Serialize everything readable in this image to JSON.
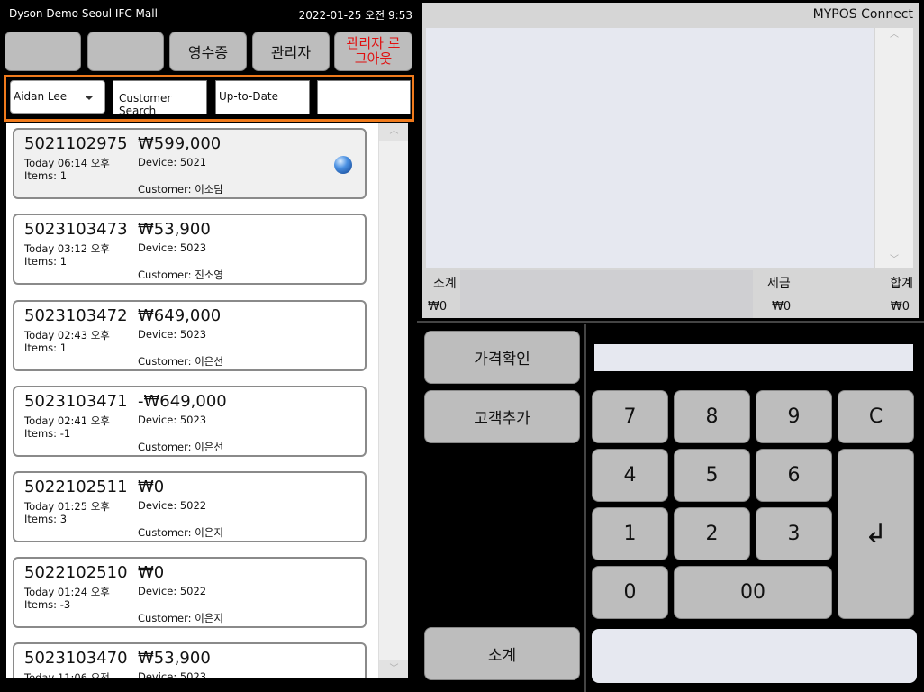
{
  "header": {
    "store": "Dyson Demo Seoul IFC Mall",
    "datetime": "2022-01-25 오전 9:53"
  },
  "top_buttons": [
    {
      "label": ""
    },
    {
      "label": ""
    },
    {
      "label": "영수증"
    },
    {
      "label": "관리자"
    },
    {
      "label": "관리자 로그아웃"
    }
  ],
  "filters": {
    "user": "Aidan Lee",
    "customer_search": "Customer Search",
    "date_filter": "Up-to-Date",
    "extra": ""
  },
  "transactions": [
    {
      "number": "5021102975",
      "amount": "₩599,000",
      "time": "Today 06:14 오후",
      "items": "Items: 1",
      "device": "Device: 5021",
      "customer": "Customer: 이소담"
    },
    {
      "number": "5023103473",
      "amount": "₩53,900",
      "time": "Today 03:12 오후",
      "items": "Items: 1",
      "device": "Device: 5023",
      "customer": "Customer: 진소영"
    },
    {
      "number": "5023103472",
      "amount": "₩649,000",
      "time": "Today 02:43 오후",
      "items": "Items: 1",
      "device": "Device: 5023",
      "customer": "Customer: 이은선"
    },
    {
      "number": "5023103471",
      "amount": "-₩649,000",
      "time": "Today 02:41 오후",
      "items": "Items: -1",
      "device": "Device: 5023",
      "customer": "Customer: 이은선"
    },
    {
      "number": "5022102511",
      "amount": "₩0",
      "time": "Today 01:25 오후",
      "items": "Items: 3",
      "device": "Device: 5022",
      "customer": "Customer: 이은지"
    },
    {
      "number": "5022102510",
      "amount": "₩0",
      "time": "Today 01:24 오후",
      "items": "Items: -3",
      "device": "Device: 5022",
      "customer": "Customer: 이은지"
    },
    {
      "number": "5023103470",
      "amount": "₩53,900",
      "time": "Today 11:06 오전",
      "items": "",
      "device": "Device: 5023",
      "customer": ""
    }
  ],
  "receipt": {
    "title": "MYPOS Connect",
    "subtotal_label": "소계",
    "tax_label": "세금",
    "total_label": "합계",
    "subtotal": "₩0",
    "tax": "₩0",
    "total": "₩0"
  },
  "function_buttons": {
    "price_check": "가격확인",
    "add_customer": "고객추가",
    "subtotal": "소계"
  },
  "keypad": {
    "k7": "7",
    "k8": "8",
    "k9": "9",
    "clear": "C",
    "k4": "4",
    "k5": "5",
    "k6": "6",
    "k1": "1",
    "k2": "2",
    "k3": "3",
    "k0": "0",
    "k00": "00",
    "enter": "↲"
  },
  "colors": {
    "accent_border": "#f07a1c",
    "logout_text": "#e01010",
    "button_gray": "#bdbdbd"
  },
  "icons": {
    "selected_indicator": "blue-orb-icon",
    "enter_key": "enter-arrow-icon",
    "dropdown": "chevron-down-icon"
  }
}
